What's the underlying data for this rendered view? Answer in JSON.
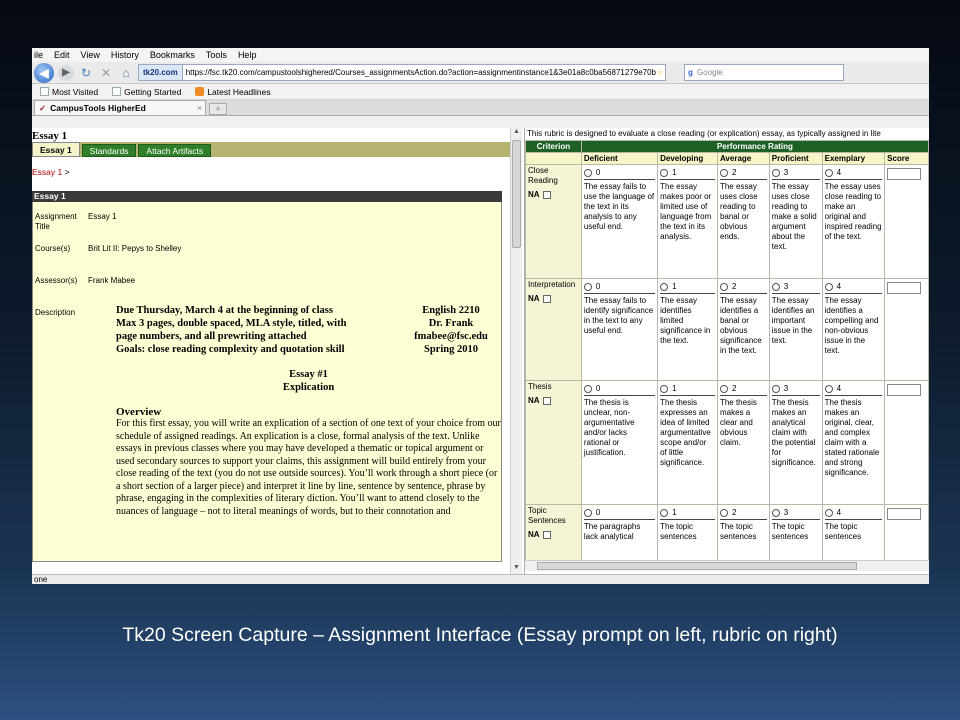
{
  "browser": {
    "menu": [
      "ile",
      "Edit",
      "View",
      "History",
      "Bookmarks",
      "Tools",
      "Help"
    ],
    "badge": "tk20.com",
    "url": "https://fsc.tk20.com/campustoolshighered/Courses_assignmentsAction.do?action=assignmentinstance1&3e01a8c0ba56871279e70b",
    "search_placeholder": "Google",
    "bookmarks": [
      "Most Visited",
      "Getting Started",
      "Latest Headlines"
    ],
    "tab_title": "CampusTools HigherEd",
    "status": "one"
  },
  "left": {
    "title": "Essay 1",
    "tabs": [
      "Essay 1",
      "Standards",
      "Attach Artifacts"
    ],
    "crumb": "Essay 1",
    "crumb_sep": ">",
    "panel_title": "Essay 1",
    "fields": [
      {
        "label": "Assignment Title",
        "value": "Essay 1"
      },
      {
        "label": "Course(s)",
        "value": "Brit Lit II: Pepys to Shelley"
      },
      {
        "label": "Assessor(s)",
        "value": "Frank Mabee"
      },
      {
        "label": "Description",
        "value": ""
      }
    ],
    "desc": {
      "left_lines": [
        "Due Thursday, March 4 at the beginning of class",
        "Max 3 pages, double spaced, MLA style, titled, with",
        "page numbers, and all prewriting attached",
        "Goals: close reading complexity and quotation skill"
      ],
      "right_lines": [
        "English 2210",
        "Dr. Frank",
        "fmabee@fsc.edu",
        "Spring 2010"
      ],
      "essay_no": "Essay #1",
      "essay_type": "Explication",
      "overview_title": "Overview",
      "overview_text": "For this first essay, you will write an explication of a section of one text of your choice from our schedule of assigned readings. An explication is a close, formal analysis of the text. Unlike essays in previous classes where you may have developed a thematic or topical argument or used secondary sources to support your claims, this assignment will build entirely from your close reading of the text (you do not use outside sources). You’ll work through a short piece (or a short section of a larger piece) and interpret it line by line, sentence by sentence, phrase by phrase, engaging in the complexities of literary diction. You’ll want to attend closely to the nuances of language – not to literal meanings of words, but to their connotation and"
    }
  },
  "rubric": {
    "intro": "This rubric is designed to evaluate a close reading (or explication) essay, as typically assigned in lite",
    "head_criterion": "Criterion",
    "head_rating": "Performance Rating",
    "levels": [
      "Deficient",
      "Developing",
      "Average",
      "Proficient",
      "Exemplary",
      "Score"
    ],
    "na_label": "NA",
    "rows": [
      {
        "criterion": "Close Reading",
        "descs": [
          "The essay fails to use the language of the text in its analysis to any useful end.",
          "The essay makes poor or limited use of language from the text in its analysis.",
          "The essay uses close reading to banal or obvious ends.",
          "The essay uses close reading to make a solid argument about the text.",
          "The essay uses close reading to make an original and inspired reading of the text."
        ]
      },
      {
        "criterion": "Interpretation",
        "descs": [
          "The essay fails to identify significance in the text to any useful end.",
          "The essay identifies limited significance in the text.",
          "The essay identifies a banal or obvious significance in the text.",
          "The essay identifies an important issue in the text.",
          "The essay identifies a compelling and non-obvious issue in the text."
        ]
      },
      {
        "criterion": "Thesis",
        "descs": [
          "The thesis is unclear, non-argumentative and/or lacks rational or justification.",
          "The thesis expresses an idea of limited argumentative scope and/or of little significance.",
          "The thesis makes a clear and obvious claim.",
          "The thesis makes an analytical claim with the potential for significance.",
          "The thesis makes an original, clear, and complex claim with a stated rationale and strong significance."
        ]
      },
      {
        "criterion": "Topic Sentences",
        "descs": [
          "The paragraphs lack analytical",
          "The topic sentences",
          "The topic sentences",
          "The topic sentences",
          "The topic sentences"
        ]
      }
    ],
    "scores": [
      "0",
      "1",
      "2",
      "3",
      "4"
    ]
  },
  "caption": "Tk20 Screen Capture – Assignment Interface (Essay prompt on left, rubric on right)"
}
